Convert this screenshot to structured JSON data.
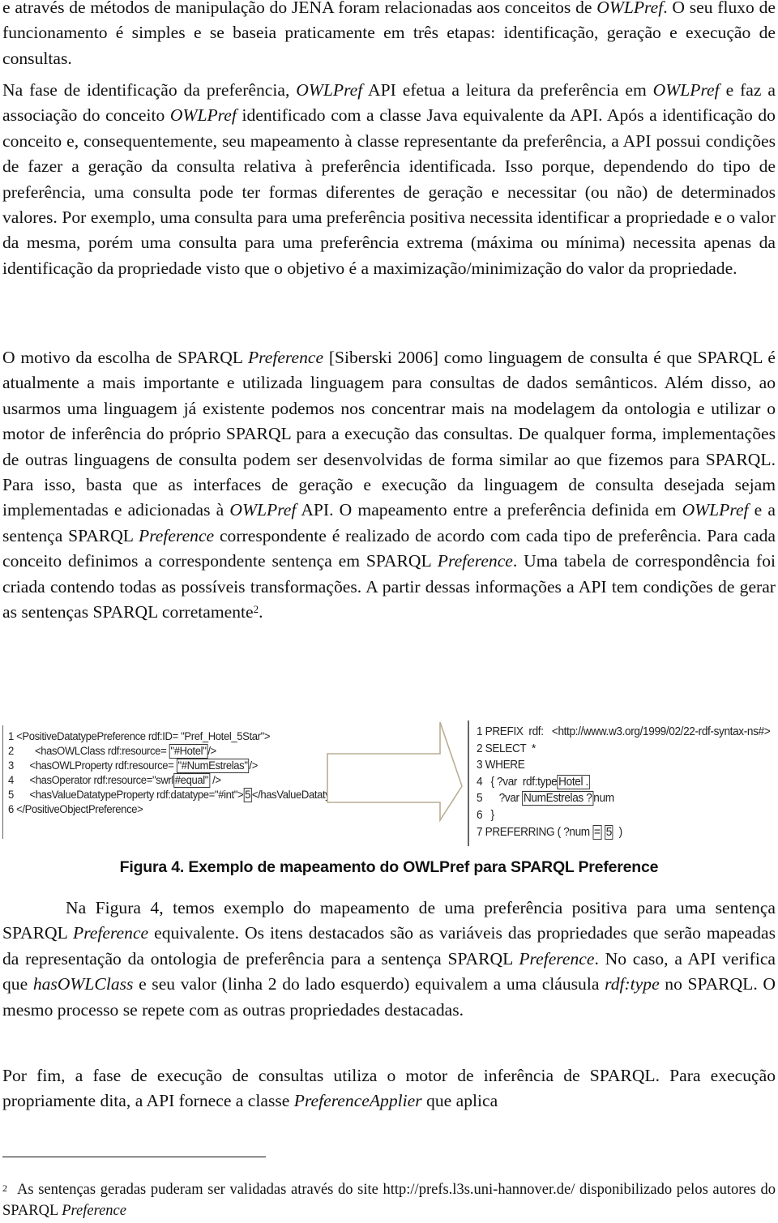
{
  "paragraphs": {
    "p1": {
      "t1": "e através de métodos de manipulação do JENA foram relacionadas aos conceitos de ",
      "i1": "OWLPref",
      "t2": ". O seu fluxo de funcionamento é simples e se baseia praticamente em três etapas: identificação, geração e execução de consultas."
    },
    "p2": {
      "t1": "Na fase de identificação da preferência, ",
      "i1": "OWLPref",
      "t2": " API efetua a leitura da preferência em ",
      "i2": "OWLPref",
      "t3": " e faz a associação do conceito ",
      "i3": "OWLPref",
      "t4": " identificado com a classe Java equivalente da API. Após a identificação do conceito e, consequentemente, seu mapeamento à classe representante da preferência, a API possui condições de fazer a geração da consulta relativa à preferência identificada. Isso porque, dependendo do tipo de preferência, uma consulta pode ter formas diferentes de geração e necessitar (ou não) de determinados valores. Por exemplo, uma consulta para uma preferência positiva necessita identificar a propriedade e o valor da mesma, porém uma consulta para uma preferência extrema (máxima ou mínima) necessita apenas da identificação da propriedade visto que o objetivo é a maximização/minimização do valor da propriedade."
    },
    "p3": {
      "t1": "O motivo da escolha de SPARQL ",
      "i1": "Preference",
      "t2": " [Siberski 2006] como linguagem de consulta é que SPARQL é atualmente a mais importante e utilizada linguagem para consultas de dados semânticos. Além disso, ao usarmos uma linguagem já existente podemos nos concentrar mais na modelagem da ontologia e utilizar o motor de inferência do próprio SPARQL para a execução das consultas. De qualquer forma, implementações de outras linguagens de consulta podem ser desenvolvidas de forma similar ao que fizemos para SPARQL. Para isso, basta que as interfaces de geração e execução da linguagem de consulta desejada sejam implementadas e adicionadas à ",
      "i2": "OWLPref",
      "t3": " API. O mapeamento entre a preferência definida em ",
      "i3": "OWLPref",
      "t4": " e a sentença SPARQL ",
      "i4": "Preference",
      "t5": " correspondente é realizado de acordo com cada tipo de preferência. Para cada conceito definimos a correspondente sentença em SPARQL ",
      "i5": "Preference",
      "t6": ". Uma tabela de correspondência foi criada contendo todas as possíveis transformações. A partir dessas informações a API tem condições de gerar as sentenças SPARQL corretamente",
      "sup": "2",
      "t7": "."
    },
    "p4": {
      "t1": "Na Figura 4, temos exemplo do mapeamento de uma preferência positiva para uma sentença SPARQL ",
      "i1": "Preference",
      "t2": " equivalente. Os itens destacados são as variáveis das propriedades que serão mapeadas da representação da ontologia de preferência para a sentença SPARQL ",
      "i2": "Preference",
      "t3": ". No caso, a API verifica que ",
      "i3": "hasOWLClass",
      "t4": " e seu valor (linha 2 do lado esquerdo) equivalem a uma cláusula ",
      "i4": "rdf:type",
      "t5": " no SPARQL. O mesmo processo se repete com as outras propriedades destacadas."
    },
    "p5": {
      "t1": "Por fim, a fase de execução de consultas utiliza o motor de inferência de SPARQL. Para execução propriamente dita, a API fornece a classe ",
      "i1": "PreferenceApplier",
      "t2": " que aplica"
    }
  },
  "figure": {
    "owl_code": [
      {
        "n": "1",
        "pre": " <PositiveDatatypePreference rdf:ID= \"Pref_Hotel_5Star\">",
        "hl": "",
        "post": ""
      },
      {
        "n": "2",
        "pre": "        <hasOWLClass rdf:resource= ",
        "hl": "\"#Hotel\"",
        "post": "/>"
      },
      {
        "n": "3",
        "pre": "      <hasOWLProperty rdf:resource= ",
        "hl": "\"#NumEstrelas\"",
        "post": "/>"
      },
      {
        "n": "4",
        "pre": "      <hasOperator rdf:resource=\"swrl",
        "hl": "#equal\"",
        "post": " />"
      },
      {
        "n": "5",
        "pre": "      <hasValueDatatypeProperty rdf:datatype=\"#int\">",
        "hl": "5",
        "post": "</hasValueDatatypeProperty>"
      },
      {
        "n": "6",
        "pre": " </PositiveObjectPreference>",
        "hl": "",
        "post": ""
      }
    ],
    "sparql_code": [
      {
        "n": "1",
        "pre": " PREFIX  rdf:   <http://www.w3.org/1999/02/22-rdf-syntax-ns#>",
        "hl": "",
        "post": "",
        "hl2": "",
        "post2": ""
      },
      {
        "n": "2",
        "pre": " SELECT  *",
        "hl": "",
        "post": "",
        "hl2": "",
        "post2": ""
      },
      {
        "n": "3",
        "pre": " WHERE",
        "hl": "",
        "post": "",
        "hl2": "",
        "post2": ""
      },
      {
        "n": "4",
        "pre": "   { ?var  rdf:type",
        "hl": "Hotel .",
        "post": "",
        "hl2": "",
        "post2": ""
      },
      {
        "n": "5",
        "pre": "      ?var ",
        "hl": "NumEstrelas ?",
        "post": "num",
        "hl2": "",
        "post2": ""
      },
      {
        "n": "6",
        "pre": "   }",
        "hl": "",
        "post": "",
        "hl2": "",
        "post2": ""
      },
      {
        "n": "7",
        "pre": " PREFERRING ( ?num ",
        "hl": "=",
        "post": " ",
        "hl2": "5",
        "post2": "  )"
      }
    ],
    "caption": "Figura 4. Exemplo de mapeamento do OWLPref para SPARQL Preference"
  },
  "footnote": {
    "number": "2",
    "t1": "As sentenças geradas puderam ser validadas através do site http://prefs.l3s.uni-hannover.de/ disponibilizado pelos autores do SPARQL ",
    "i1": "Preference"
  }
}
